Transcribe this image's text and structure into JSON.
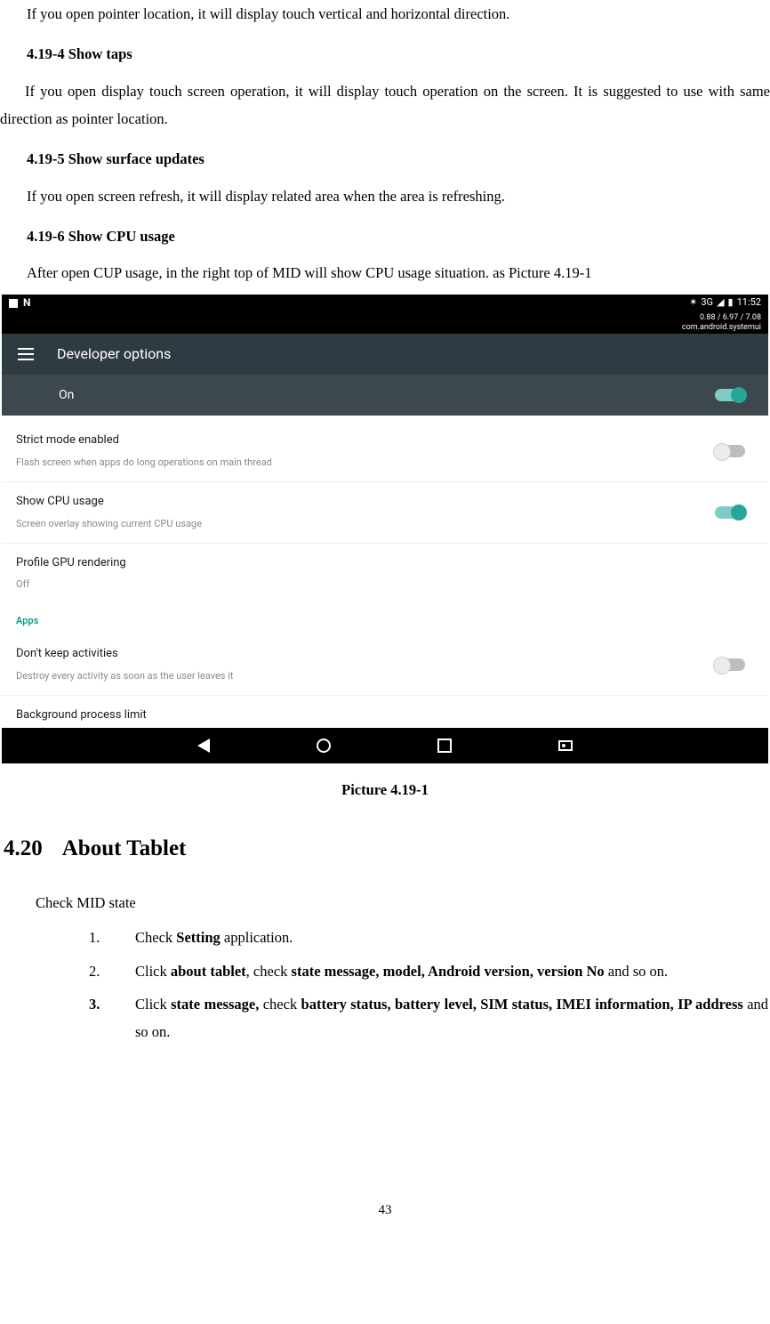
{
  "doc": {
    "p1": "If you open pointer location, it will display touch vertical and horizontal direction.",
    "h_4_19_4": "4.19-4 Show taps",
    "p2": "If you open display touch screen operation, it will display touch operation on the screen. It is suggested to use with same direction as pointer location.",
    "h_4_19_5": "4.19-5 Show surface updates",
    "p3": "If you open screen refresh, it will display related area when the area is refreshing.",
    "h_4_19_6": "4.19-6 Show CPU usage",
    "p4": "After open CUP usage, in the right top of MID will show CPU usage situation. as Picture 4.19-1",
    "caption": "Picture 4.19-1",
    "h_4_20_num": "4.20",
    "h_4_20_title": "About Tablet",
    "sub1": "Check MID state",
    "li1_marker": "1.",
    "li1_a": "Check ",
    "li1_b": "Setting",
    "li1_c": " application.",
    "li2_marker": "2.",
    "li2_a": "Click ",
    "li2_b": "about tablet",
    "li2_c": ", check ",
    "li2_d": "state message, model, Android version, version No",
    "li2_e": " and so on.",
    "li3_marker": "3.",
    "li3_a": "Click ",
    "li3_b": "state message,",
    "li3_c": " check ",
    "li3_d": "battery status, battery level, SIM status, IMEI information, IP address",
    "li3_e": " and so on.",
    "page_number": "43"
  },
  "screenshot": {
    "status_left_n": "N",
    "status_3g": "3G",
    "status_time": "11:52",
    "cpu_line1": "0.88 / 6.97 / 7.08",
    "cpu_line2": "com.android.systemui",
    "screen_title": "Developer options",
    "on_label": "On",
    "rows": {
      "r1_title": "Strict mode enabled",
      "r1_desc": "Flash screen when apps do long operations on main thread",
      "r2_title": "Show CPU usage",
      "r2_desc": "Screen overlay showing current CPU usage",
      "r3_title": "Profile GPU rendering",
      "r3_desc": "Off",
      "apps_header": "Apps",
      "r4_title": "Don't keep activities",
      "r4_desc": "Destroy every activity as soon as the user leaves it",
      "r5_title": "Background process limit"
    }
  }
}
